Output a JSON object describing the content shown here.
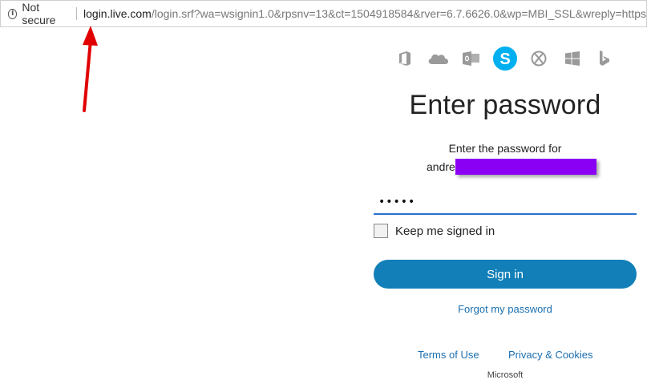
{
  "browser": {
    "security_label": "Not secure",
    "url_host": "login.live.com",
    "url_rest": "/login.srf?wa=wsignin1.0&rpsnv=13&ct=1504918584&rver=6.7.6626.0&wp=MBI_SSL&wreply=https"
  },
  "products": [
    {
      "name": "office-icon"
    },
    {
      "name": "onedrive-icon"
    },
    {
      "name": "outlook-icon"
    },
    {
      "name": "skype-icon",
      "color": "#00aff0"
    },
    {
      "name": "xbox-icon"
    },
    {
      "name": "windows-icon"
    },
    {
      "name": "bing-icon"
    }
  ],
  "login": {
    "title": "Enter password",
    "subtitle": "Enter the password for",
    "account_prefix": "andre",
    "password_mask": "•••••",
    "keep_signed_in": "Keep me signed in",
    "sign_in": "Sign in",
    "forgot_password": "Forgot my password"
  },
  "footer": {
    "terms": "Terms of Use",
    "privacy": "Privacy & Cookies",
    "brand": "Microsoft"
  },
  "colors": {
    "primary_button": "#127fb8",
    "link": "#1a6fb0",
    "redaction": "#8a00f5",
    "annotation_arrow": "#e00000"
  }
}
